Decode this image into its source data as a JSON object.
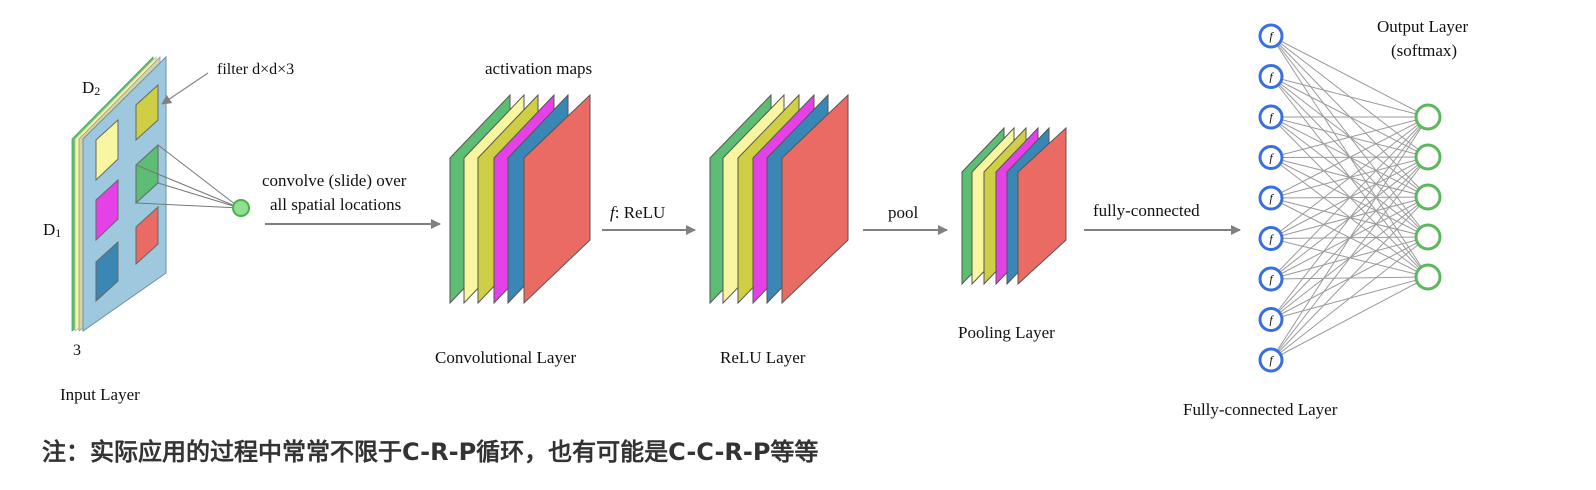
{
  "labels": {
    "filter": "filter  d×d×3",
    "d2": "D",
    "d2_sub": "2",
    "d1": "D",
    "d1_sub": "1",
    "depth": "3",
    "input_layer": "Input Layer",
    "convolve_1": "convolve (slide) over",
    "convolve_2": "all spatial locations",
    "activation_maps": "activation maps",
    "conv_layer": "Convolutional Layer",
    "relu_f": "f",
    "relu_text": ": ReLU",
    "relu_layer": "ReLU Layer",
    "pool": "pool",
    "pooling_layer": "Pooling Layer",
    "fully_connected": "fully-connected",
    "fc_layer": "Fully-connected Layer",
    "output_layer_1": "Output Layer",
    "output_layer_2": "(softmax)",
    "neuron_symbol": "f"
  },
  "note": "注：实际应用的过程中常常不限于C-R-P循环，也有可能是C-C-R-P等等",
  "colors": {
    "input_face": "#9ec8de",
    "map_colors": [
      "#5dbd73",
      "#f8f6a0",
      "#cfcf45",
      "#e441e6",
      "#3a86b4",
      "#e96b64"
    ],
    "input_neuron": "#3a6fe0",
    "output_neuron": "#5bb85d",
    "arrow": "#808080"
  },
  "network": {
    "input_neurons": 9,
    "output_neurons": 5
  }
}
